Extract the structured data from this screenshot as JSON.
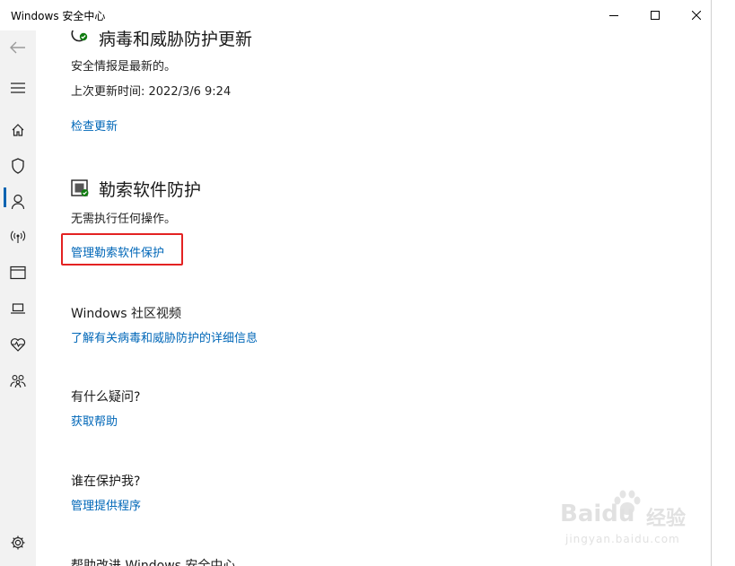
{
  "window": {
    "title": "Windows 安全中心"
  },
  "sections": {
    "updates": {
      "title": "病毒和威胁防护更新",
      "status": "安全情报是最新的。",
      "last_update": "上次更新时间: 2022/3/6 9:24",
      "check_link": "检查更新"
    },
    "ransomware": {
      "title": "勒索软件防护",
      "status": "无需执行任何操作。",
      "manage_link": "管理勒索软件保护"
    },
    "community": {
      "title": "Windows 社区视频",
      "link": "了解有关病毒和威胁防护的详细信息"
    },
    "questions": {
      "title": "有什么疑问?",
      "link": "获取帮助"
    },
    "protector": {
      "title": "谁在保护我?",
      "link": "管理提供程序"
    },
    "improve": {
      "title": "帮助改进 Windows 安全中心"
    }
  },
  "watermark": {
    "brand": "Baidu",
    "cn": "经验",
    "url": "jingyan.baidu.com"
  },
  "colors": {
    "link": "#0067b8",
    "highlight": "#e32222",
    "accent": "#0063b1",
    "sidebar_bg": "#f2f2f2"
  }
}
